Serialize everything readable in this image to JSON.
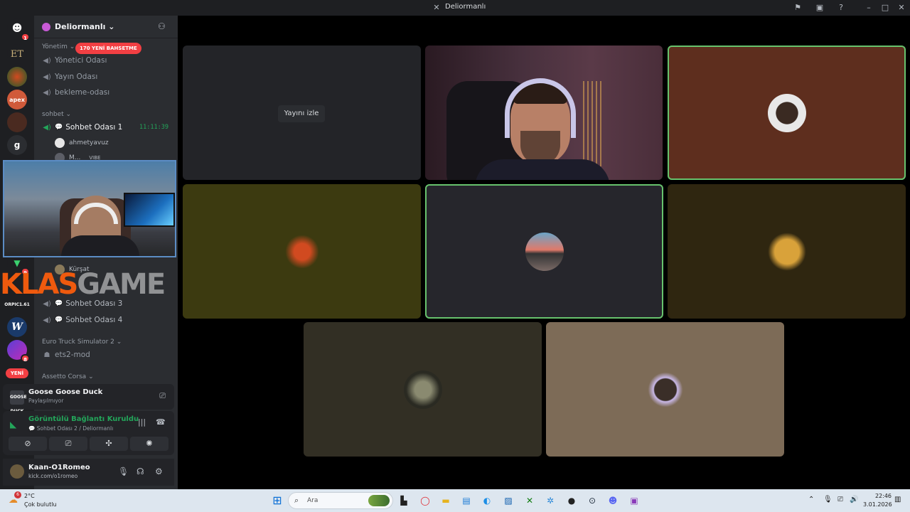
{
  "window": {
    "title": "Deliormanlı"
  },
  "server": {
    "name": "Deliormanlı",
    "mention_pill": "170 YENİ BAHSETME",
    "new_pill": "YENİ",
    "rail_badges": {
      "home": "1",
      "green_server": "9",
      "blue_server": "8"
    },
    "rail_labels": {
      "et": "ET",
      "apex": "apex",
      "g": "g",
      "orpic": "ORPIC1.61",
      "w": "W"
    }
  },
  "sidebar": {
    "categories": {
      "yonetim": "Yönetim",
      "sohbet": "sohbet",
      "ets": "Euro Truck Simulator 2",
      "assetto": "Assetto Corsa"
    },
    "channels": {
      "yonetici": "Yönetici Odası",
      "yayin": "Yayın Odası",
      "bekleme": "bekleme-odası",
      "sohbet1": "Sohbet Odası 1",
      "sohbet3": "Sohbet Odası 3",
      "sohbet4": "Sohbet Odası 4",
      "ets2mod": "ets2-mod"
    },
    "sohbet1_timer": "11:11:39",
    "users": {
      "u1": "ahmetyavuz",
      "u2": "M...",
      "u2_tag": "VIBE",
      "u3": "Kürşat"
    },
    "overlay_text": {
      "part1": "KLAS",
      "part2": "GAME"
    }
  },
  "activity": {
    "game_icon": "GOOSE DUCK",
    "game": "Goose Goose Duck",
    "status": "Paylaşılmıyor"
  },
  "voice": {
    "title": "Görüntülü Bağlantı Kuruldu",
    "location": "Sohbet Odası 2 / Deliormanlı"
  },
  "user_panel": {
    "name": "Kaan-O1Romeo",
    "status": "kick.com/o1romeo"
  },
  "stage": {
    "watch_button": "Yayını izle",
    "tile_colors": {
      "tile1": "#232428",
      "tile3": "#5e2e1e",
      "tile4": "#3c3a10",
      "tile5": "#26262c",
      "tile6": "#2f2610",
      "tile7": "#322f24",
      "tile8": "#7d6b57"
    }
  },
  "taskbar": {
    "weather_badge": "6",
    "temperature": "2°C",
    "weather": "Çok bulutlu",
    "search_placeholder": "Ara",
    "time": "22:46",
    "date": "3.01.2026"
  },
  "colors": {
    "accent_green": "#23a55a",
    "speaking_outline": "#67c26d",
    "alert_red": "#f23f43"
  }
}
